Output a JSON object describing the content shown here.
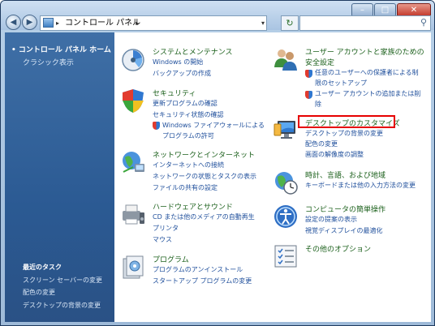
{
  "window": {
    "controls": {
      "minimize": "–",
      "maximize": "□",
      "close": "✕"
    }
  },
  "toolbar": {
    "breadcrumb": "コントロール パネル",
    "back_glyph": "◀",
    "forward_glyph": "▶",
    "refresh_glyph": "↻",
    "search_placeholder": ""
  },
  "sidebar": {
    "home": "コントロール パネル ホーム",
    "classic": "クラシック表示",
    "recent_heading": "最近のタスク",
    "recent_items": [
      "スクリーン セーバーの変更",
      "配色の変更",
      "デスクトップの背景の変更"
    ]
  },
  "categories": {
    "system": {
      "title": "システムとメンテナンス",
      "links": [
        "Windows の開始",
        "バックアップの作成"
      ]
    },
    "security": {
      "title": "セキュリティ",
      "links": [
        "更新プログラムの確認",
        "セキュリティ状態の確認",
        "Windows ファイアウォールによる",
        "プログラムの許可"
      ]
    },
    "network": {
      "title": "ネットワークとインターネット",
      "links": [
        "インターネットへの接続",
        "ネットワークの状態とタスクの表示",
        "ファイルの共有の設定"
      ]
    },
    "hardware": {
      "title": "ハードウェアとサウンド",
      "links": [
        "CD または他のメディアの自動再生",
        "プリンタ",
        "マウス"
      ]
    },
    "programs": {
      "title": "プログラム",
      "links": [
        "プログラムのアンインストール",
        "スタートアップ プログラムの変更"
      ]
    },
    "users": {
      "title": "ユーザー アカウントと家族のための",
      "title2": "安全設定",
      "links": [
        "任意のユーザーへの保護者による制",
        "限のセットアップ",
        "ユーザー アカウントの追加または削",
        "除"
      ]
    },
    "appearance": {
      "title": "デスクトップのカスタマイズ",
      "links": [
        "デスクトップの背景の変更",
        "配色の変更",
        "画面の解像度の調整"
      ]
    },
    "clock": {
      "title": "時計、言語、および地域",
      "links": [
        "キーボードまたは他の入力方法の変更"
      ]
    },
    "ease": {
      "title": "コンピュータの簡単操作",
      "links": [
        "設定の提案の表示",
        "視覚ディスプレイの最適化"
      ]
    },
    "other": {
      "title": "その他のオプション",
      "links": []
    }
  },
  "colors": {
    "sidebar": "#2b5a93",
    "link": "#1e4e9b",
    "category_title": "#1a5f1a",
    "highlight": "#e60000"
  }
}
